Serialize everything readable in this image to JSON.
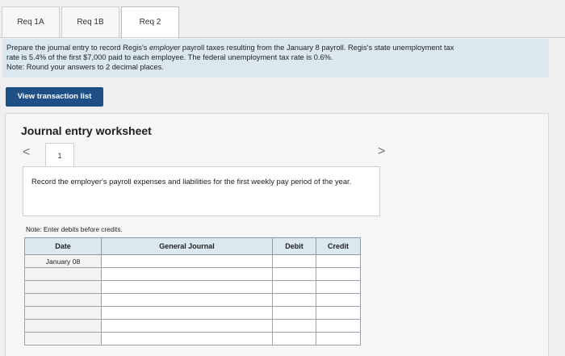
{
  "tabs": [
    {
      "label": "Req 1A",
      "active": false
    },
    {
      "label": "Req 1B",
      "active": false
    },
    {
      "label": "Req 2",
      "active": true
    }
  ],
  "instructions": {
    "line1_pre": "Prepare the journal entry to record Regis's ",
    "line1_em": "employer",
    "line1_post": " payroll taxes resulting from the January 8 payroll. Regis's state unemployment tax",
    "line2": "rate is 5.4% of the first $7,000 paid to each employee. The federal unemployment tax rate is 0.6%.",
    "line3": "Note: Round your answers to 2 decimal places."
  },
  "view_transaction_label": "View transaction list",
  "worksheet": {
    "title": "Journal entry worksheet",
    "prev_glyph": "<",
    "next_glyph": ">",
    "page_number": "1",
    "record_text": "Record the employer's payroll expenses and liabilities for the first weekly pay period of the year.",
    "note_debits": "Note: Enter debits before credits."
  },
  "journal": {
    "headers": {
      "date": "Date",
      "general_journal": "General Journal",
      "debit": "Debit",
      "credit": "Credit"
    },
    "rows": [
      {
        "date": "January 08"
      },
      {
        "date": ""
      },
      {
        "date": ""
      },
      {
        "date": ""
      },
      {
        "date": ""
      },
      {
        "date": ""
      },
      {
        "date": ""
      }
    ]
  },
  "colors": {
    "instruction_bg": "#dbe8f0",
    "button_bg": "#1e4f86",
    "table_header_bg": "#dbe8f0"
  }
}
